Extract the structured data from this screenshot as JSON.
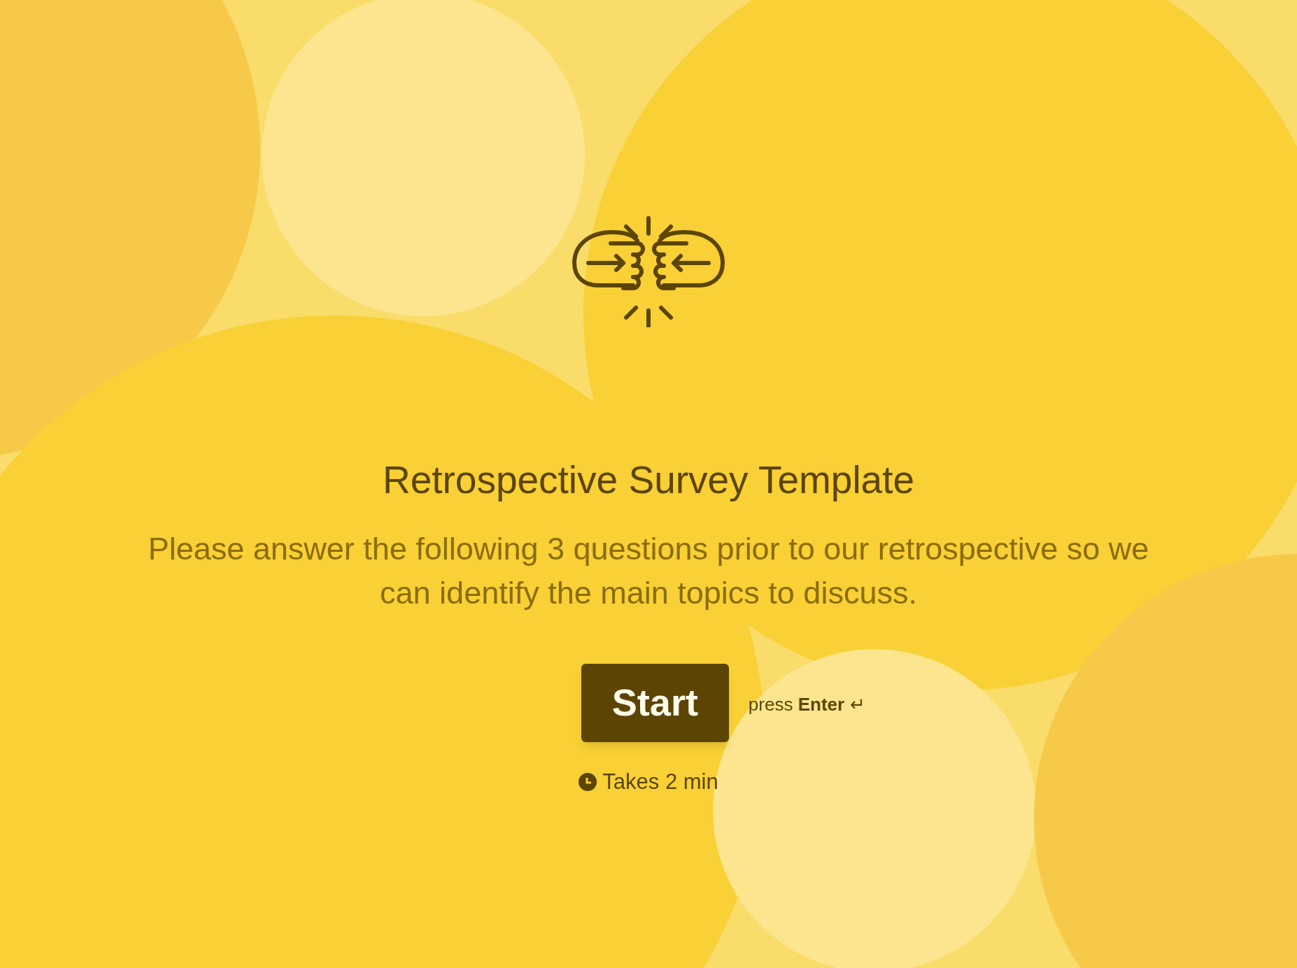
{
  "title": "Retrospective Survey Template",
  "description": "Please answer the following 3 questions prior to our retrospective so we can identify the main topics to discuss.",
  "start_button": "Start",
  "enter_hint": "press **Enter**",
  "enter_symbol": "↵",
  "duration": "Takes 2 min"
}
